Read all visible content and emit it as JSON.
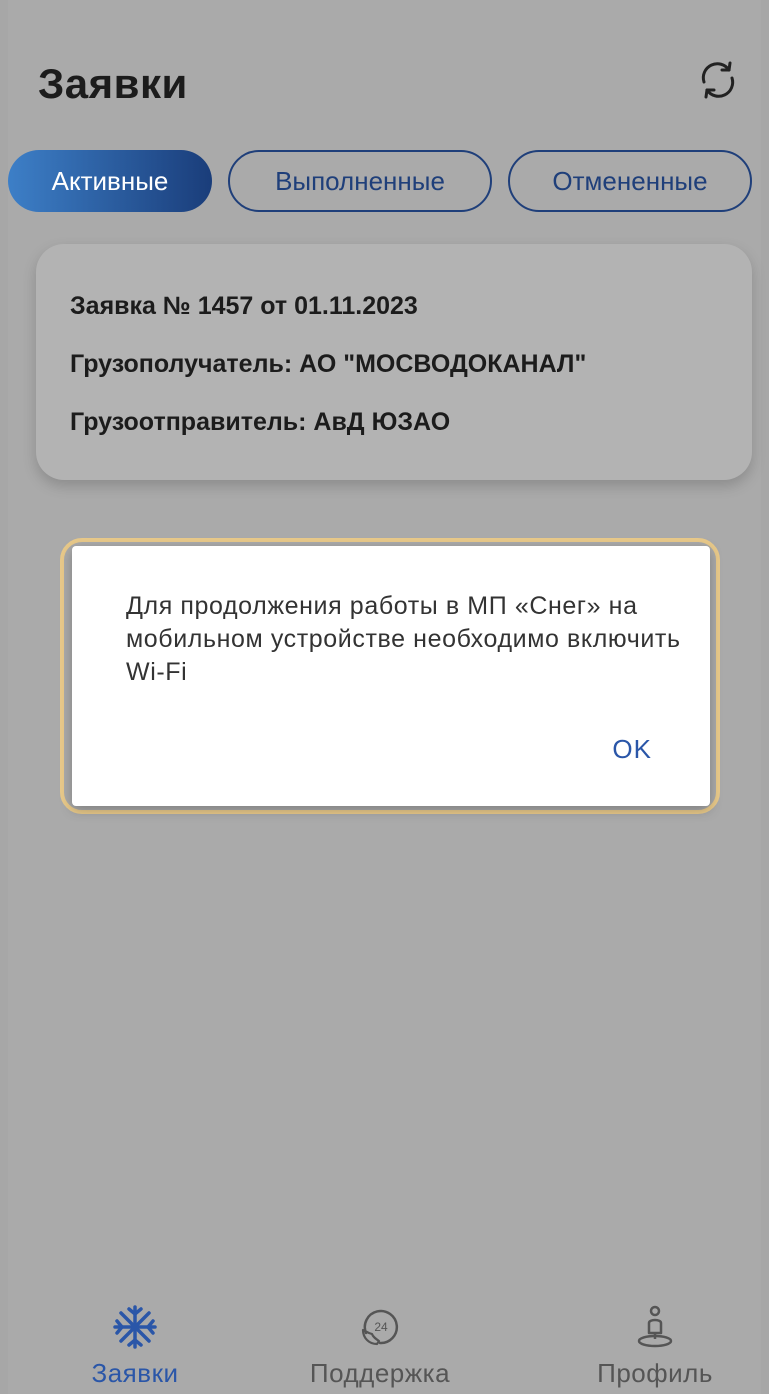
{
  "header": {
    "title": "Заявки",
    "refresh_icon": "refresh-icon"
  },
  "tabs": [
    {
      "label": "Активные",
      "active": true
    },
    {
      "label": "Выполненные",
      "active": false
    },
    {
      "label": "Отмененные",
      "active": false
    }
  ],
  "order": {
    "title": "Заявка № 1457 от 01.11.2023",
    "consignee": "Грузополучатель: АО \"МОСВОДОКАНАЛ\"",
    "shipper": "Грузоотправитель: АвД ЮЗАО"
  },
  "dialog": {
    "message": "Для продолжения работы в МП «Снег» на мобильном устройстве необходимо включить Wi-Fi",
    "ok_label": "OK"
  },
  "bottom_nav": [
    {
      "label": "Заявки",
      "icon": "snowflake-icon",
      "active": true
    },
    {
      "label": "Поддержка",
      "icon": "support-24-icon",
      "active": false
    },
    {
      "label": "Профиль",
      "icon": "profile-location-icon",
      "active": false
    }
  ],
  "colors": {
    "accent": "#2a56a8",
    "overlay": "#a7a7a7",
    "dialog_highlight": "#e8c98a"
  }
}
